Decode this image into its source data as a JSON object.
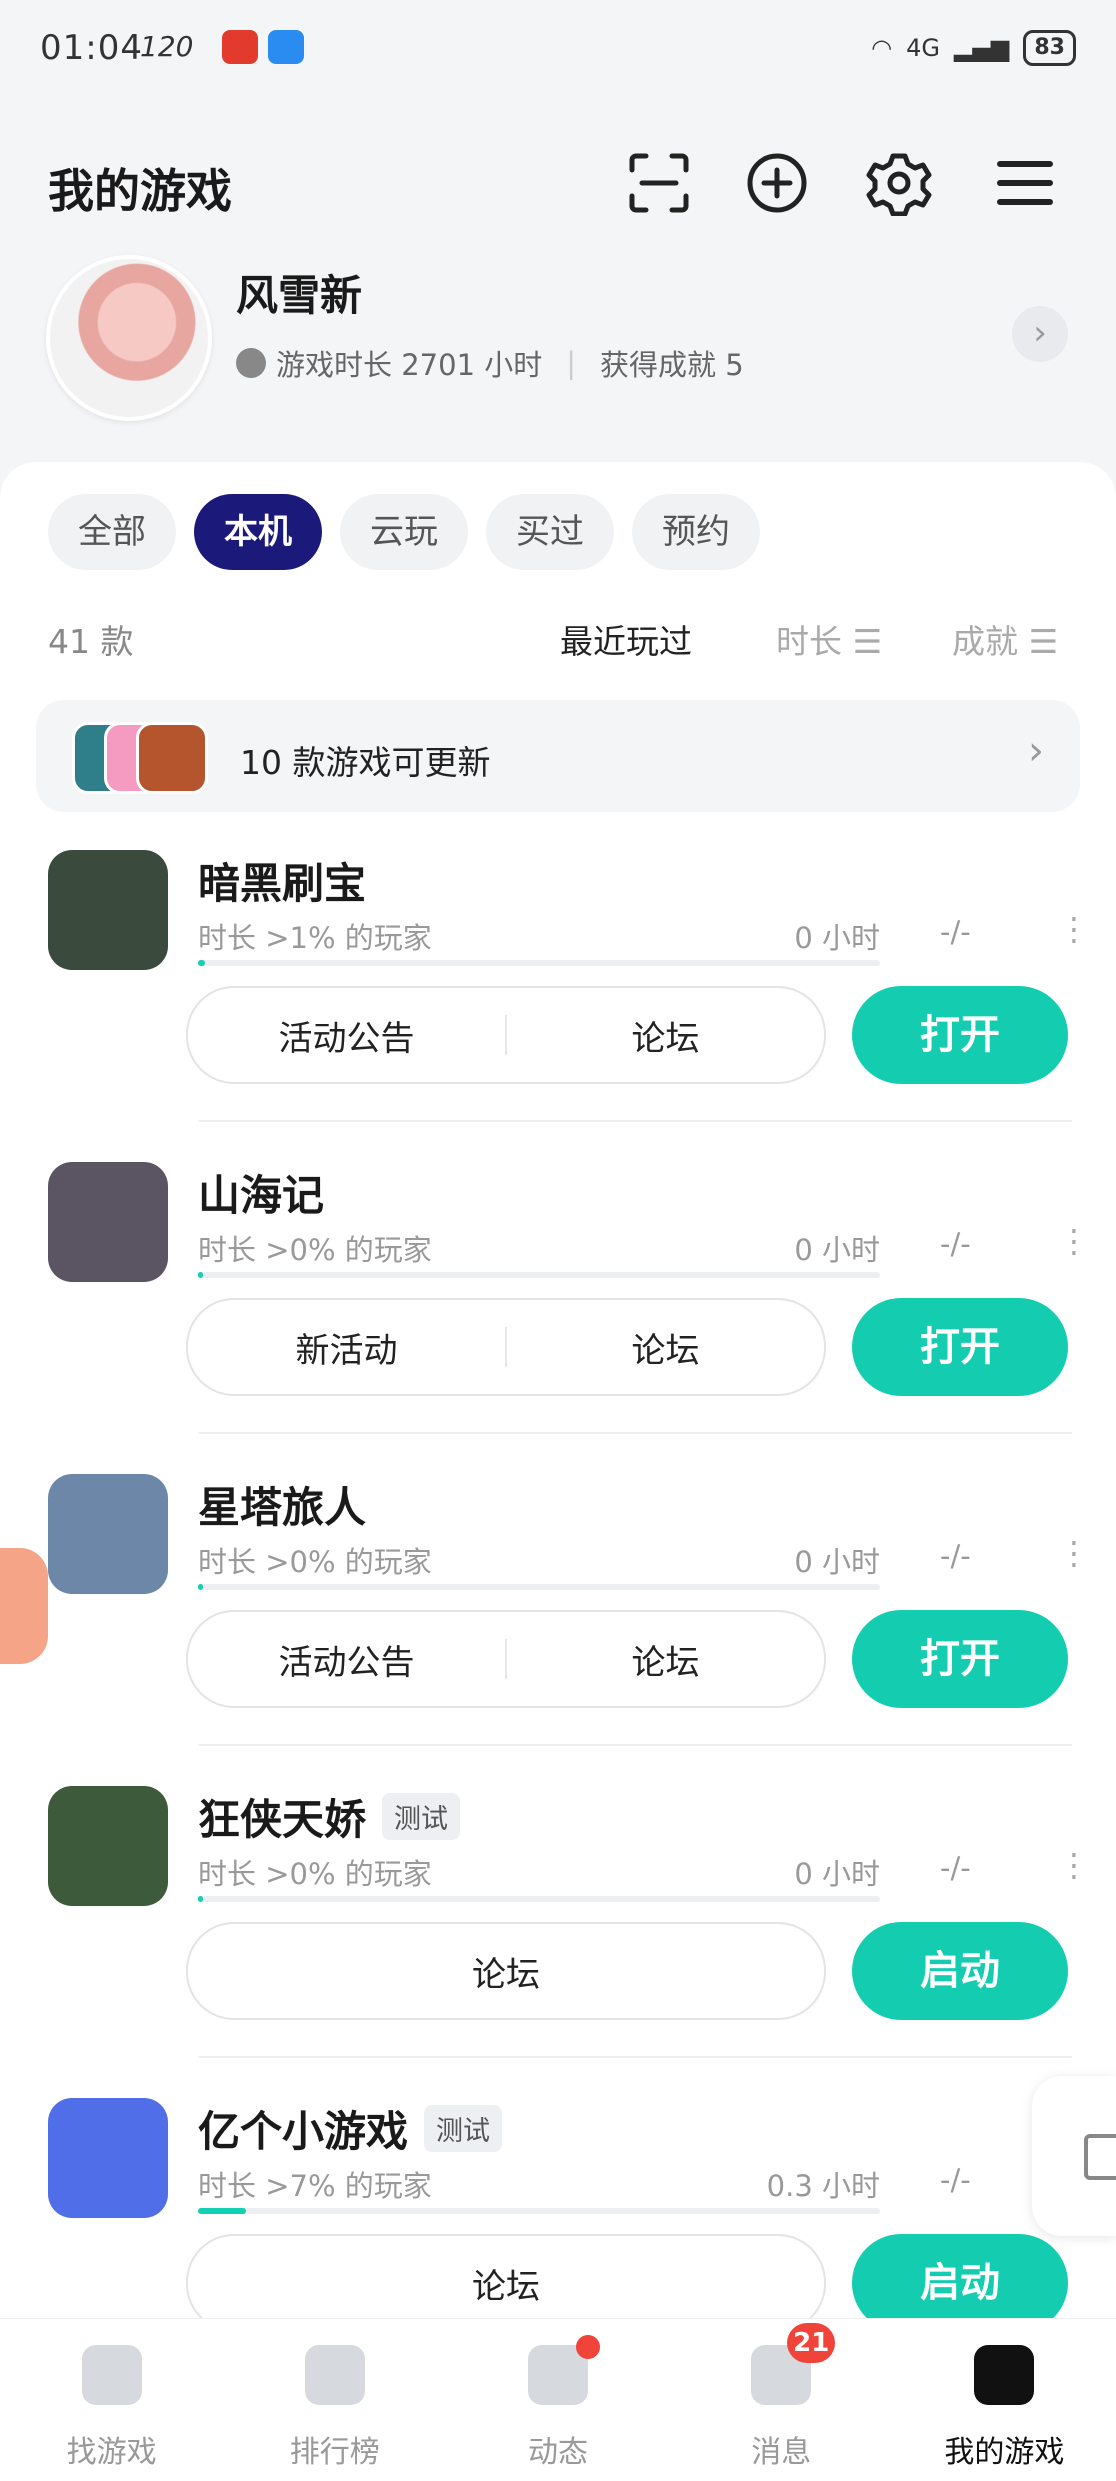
{
  "status_bar": {
    "time": "01:04",
    "refresh": "120",
    "battery": "83",
    "net": "4G"
  },
  "header": {
    "title": "我的游戏",
    "icons": [
      "scan-icon",
      "add-circle-icon",
      "gear-icon",
      "menu-icon"
    ]
  },
  "profile": {
    "name": "风雪新",
    "play_time": "游戏时长 2701 小时",
    "achievements": "获得成就 5"
  },
  "filters": [
    {
      "label": "全部",
      "active": false
    },
    {
      "label": "本机",
      "active": true
    },
    {
      "label": "云玩",
      "active": false
    },
    {
      "label": "买过",
      "active": false
    },
    {
      "label": "预约",
      "active": false
    }
  ],
  "list": {
    "count": "41 款",
    "sort": [
      {
        "label": "最近玩过",
        "active": true
      },
      {
        "label": "时长 ☰",
        "active": false
      },
      {
        "label": "成就 ☰",
        "active": false
      }
    ],
    "update_banner": "10 款游戏可更新"
  },
  "games": [
    {
      "name": "暗黑刷宝",
      "tag": "",
      "sub": "时长 >1% 的玩家",
      "hours": "0 小时",
      "achievement": "-/-",
      "progress": 0.01,
      "buttons": [
        "活动公告",
        "论坛"
      ],
      "primary": "打开"
    },
    {
      "name": "山海记",
      "tag": "",
      "sub": "时长 >0% 的玩家",
      "hours": "0 小时",
      "achievement": "-/-",
      "progress": 0.005,
      "buttons": [
        "新活动",
        "论坛"
      ],
      "primary": "打开"
    },
    {
      "name": "星塔旅人",
      "tag": "",
      "sub": "时长 >0% 的玩家",
      "hours": "0 小时",
      "achievement": "-/-",
      "progress": 0.005,
      "buttons": [
        "活动公告",
        "论坛"
      ],
      "primary": "打开"
    },
    {
      "name": "狂侠天娇",
      "tag": "测试",
      "sub": "时长 >0% 的玩家",
      "hours": "0 小时",
      "achievement": "-/-",
      "progress": 0.005,
      "buttons": [
        "论坛"
      ],
      "primary": "启动"
    },
    {
      "name": "亿个小游戏",
      "tag": "测试",
      "sub": "时长 >7% 的玩家",
      "hours": "0.3 小时",
      "achievement": "-/-",
      "progress": 0.07,
      "buttons": [
        "论坛"
      ],
      "primary": "启动"
    }
  ],
  "bottom_nav": [
    {
      "label": "找游戏",
      "icon": "find-game-icon",
      "active": false,
      "badge": ""
    },
    {
      "label": "排行榜",
      "icon": "ranking-icon",
      "active": false,
      "badge": ""
    },
    {
      "label": "动态",
      "icon": "feed-icon",
      "active": false,
      "badge": "dot"
    },
    {
      "label": "消息",
      "icon": "message-icon",
      "active": false,
      "badge": "21"
    },
    {
      "label": "我的游戏",
      "icon": "my-games-icon",
      "active": true,
      "badge": ""
    }
  ],
  "colors": {
    "accent": "#14cdb0",
    "active_chip": "#1b1a7a",
    "badge": "#f0443a"
  }
}
